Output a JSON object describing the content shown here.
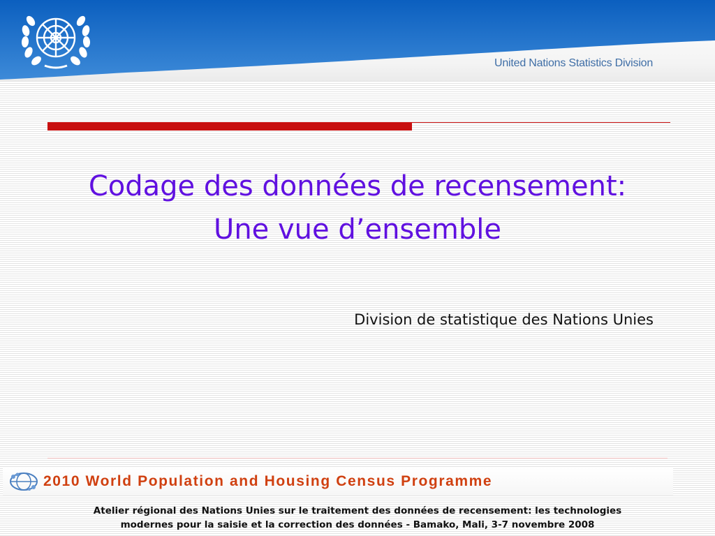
{
  "header": {
    "organization": "United Nations Statistics Division",
    "emblem_icon": "un-emblem-icon"
  },
  "title": {
    "line1": "Codage des données de recensement:",
    "line2": "Une vue d’ensemble"
  },
  "subtitle": "Division de statistique des Nations Unies",
  "banner": {
    "text": "2010 World Population and Housing Census Programme",
    "logo_icon": "census-globe-icon"
  },
  "footer": {
    "line1": "Atelier régional des Nations Unies sur le traitement des données de recensement: les technologies",
    "line2": "modernes pour la saisie et la correction des données - Bamako, Mali, 3-7 novembre 2008"
  },
  "colors": {
    "title": "#6010e0",
    "accent_red": "#c81010",
    "header_blue": "#1a6fc4",
    "banner_orange": "#d04010"
  }
}
